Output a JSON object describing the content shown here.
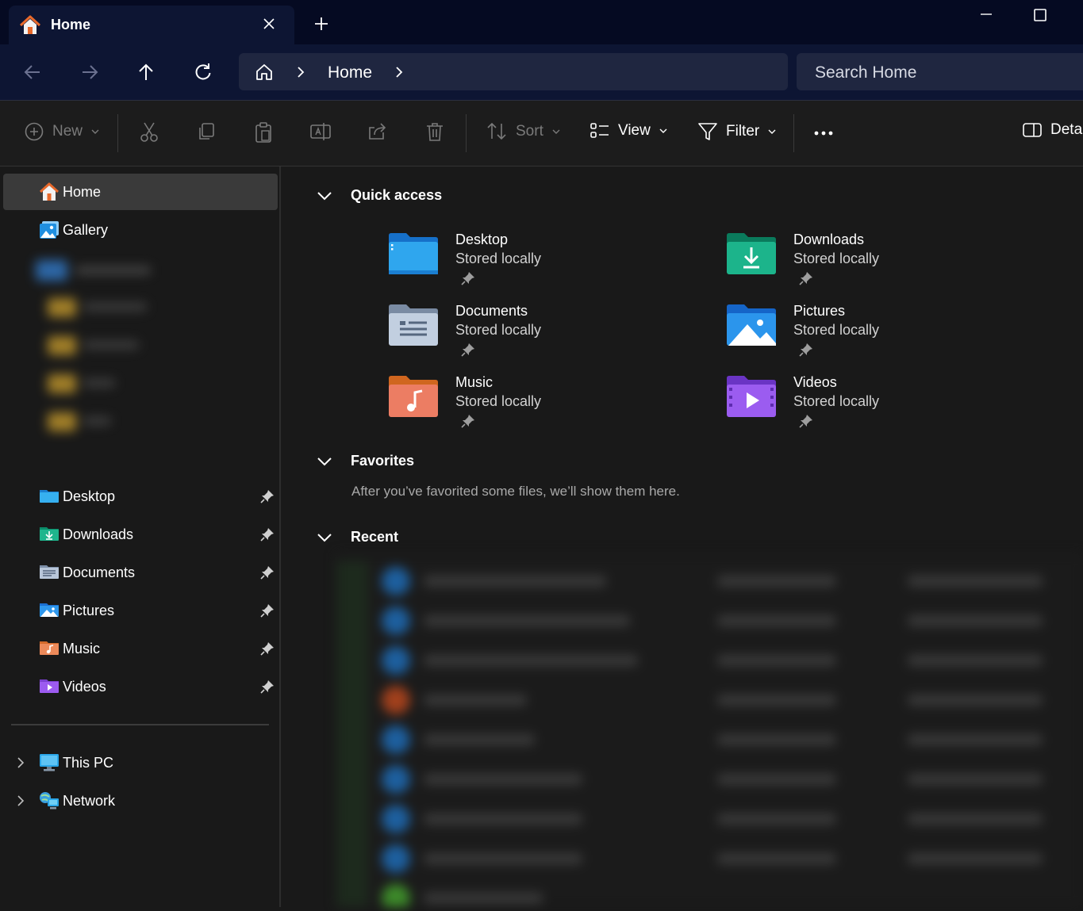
{
  "window": {
    "tab_title": "Home",
    "icons": [
      "home-icon",
      "close-icon",
      "plus-icon",
      "minimize-icon",
      "maximize-icon"
    ]
  },
  "nav": {
    "icons": [
      "back-arrow-icon",
      "forward-arrow-icon",
      "up-arrow-icon",
      "refresh-icon"
    ],
    "breadcrumb": [
      "Home"
    ],
    "search_placeholder": "Search Home"
  },
  "commands": {
    "new": "New",
    "sort": "Sort",
    "view": "View",
    "filter": "Filter",
    "details": "Details",
    "icons": [
      "cut-icon",
      "copy-icon",
      "paste-icon",
      "rename-icon",
      "share-icon",
      "delete-icon",
      "more-icon",
      "details-pane-icon"
    ]
  },
  "sidebar": {
    "top": [
      {
        "label": "Home",
        "icon": "home-icon",
        "selected": true
      },
      {
        "label": "Gallery",
        "icon": "gallery-icon"
      }
    ],
    "pinned": [
      {
        "label": "Desktop",
        "icon": "desktop-folder-icon"
      },
      {
        "label": "Downloads",
        "icon": "downloads-folder-icon"
      },
      {
        "label": "Documents",
        "icon": "documents-folder-icon"
      },
      {
        "label": "Pictures",
        "icon": "pictures-folder-icon"
      },
      {
        "label": "Music",
        "icon": "music-folder-icon"
      },
      {
        "label": "Videos",
        "icon": "videos-folder-icon"
      }
    ],
    "drives": [
      {
        "label": "This PC",
        "icon": "pc-icon"
      },
      {
        "label": "Network",
        "icon": "network-icon"
      }
    ]
  },
  "main": {
    "quick_access": {
      "title": "Quick access",
      "items": [
        {
          "name": "Desktop",
          "status": "Stored locally"
        },
        {
          "name": "Downloads",
          "status": "Stored locally"
        },
        {
          "name": "Documents",
          "status": "Stored locally"
        },
        {
          "name": "Pictures",
          "status": "Stored locally"
        },
        {
          "name": "Music",
          "status": "Stored locally"
        },
        {
          "name": "Videos",
          "status": "Stored locally"
        }
      ]
    },
    "favorites": {
      "title": "Favorites",
      "empty_text": "After you’ve favorited some files, we’ll show them here."
    },
    "recent": {
      "title": "Recent"
    }
  },
  "colors": {
    "titlebar": "#050a22",
    "navbar": "#0d1533",
    "background": "#191919",
    "selected": "#3a3a3a"
  }
}
